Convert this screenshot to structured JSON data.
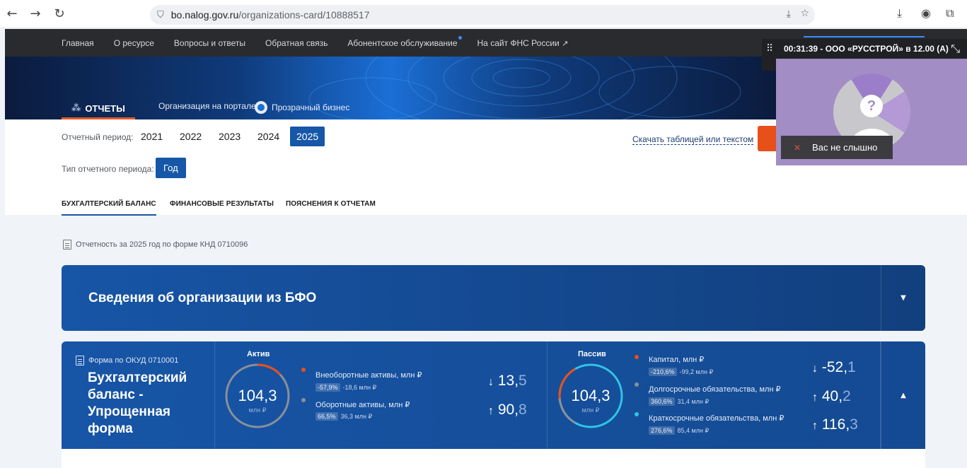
{
  "browser": {
    "url_host": "bo.nalog.gov.ru",
    "url_path": "/organizations-card/10888517"
  },
  "site_nav": {
    "items": [
      "Главная",
      "О ресурсе",
      "Вопросы и ответы",
      "Обратная связь",
      "Абонентское обслуживание",
      "На сайт ФНС России"
    ]
  },
  "hero": {
    "tab_label": "ОТЧЕТЫ",
    "org_portal": "Организация на портале",
    "transparent_business": "Прозрачный бизнес"
  },
  "filters": {
    "period_label": "Отчетный период:",
    "years": [
      "2021",
      "2022",
      "2023",
      "2024",
      "2025"
    ],
    "selected_year": "2025",
    "period_type_label": "Тип отчетного периода:",
    "period_type_value": "Год",
    "download_link": "Скачать таблицей или текстом"
  },
  "subtabs": [
    "БУХГАЛТЕРСКИЙ БАЛАНС",
    "ФИНАНСОВЫЕ РЕЗУЛЬТАТЫ",
    "ПОЯСНЕНИЯ К ОТЧЕТАМ"
  ],
  "report_note": "Отчетность за 2025 год по форме КНД 0710096",
  "org_card": {
    "title": "Сведения об организации из БФО"
  },
  "balance": {
    "okud": "Форма по ОКУД 0710001",
    "title": "Бухгалтерский баланс - Упрощенная форма",
    "aktiv": {
      "label": "Актив",
      "total": "104,3",
      "unit": "млн ₽",
      "items": [
        {
          "name": "Внеоборотные активы, млн ₽",
          "pct": "-57,9%",
          "delta": "-18,6 млн ₽",
          "arrow": "↓",
          "value_int": "13,",
          "value_frac": "5",
          "color": "#e8501a"
        },
        {
          "name": "Оборотные активы, млн ₽",
          "pct": "66,5%",
          "delta": "36,3 млн ₽",
          "arrow": "↑",
          "value_int": "90,",
          "value_frac": "8",
          "color": "#8a8f99"
        }
      ]
    },
    "passiv": {
      "label": "Пассив",
      "total": "104,3",
      "unit": "млн ₽",
      "items": [
        {
          "name": "Капитал, млн ₽",
          "pct": "-210,6%",
          "delta": "-99,2 млн ₽",
          "arrow": "↓",
          "value_int": "-52,",
          "value_frac": "1",
          "color": "#e8501a"
        },
        {
          "name": "Долгосрочные обязательства, млн ₽",
          "pct": "360,6%",
          "delta": "31,4 млн ₽",
          "arrow": "↑",
          "value_int": "40,",
          "value_frac": "2",
          "color": "#8a8f99"
        },
        {
          "name": "Краткосрочные обязательства, млн ₽",
          "pct": "276,6%",
          "delta": "85,4 млн ₽",
          "arrow": "↑",
          "value_int": "116,",
          "value_frac": "3",
          "color": "#2ec4e6"
        }
      ]
    }
  },
  "video_overlay": {
    "title": "00:31:39 - ООО «РУССТРОЙ» в 12.00 (А)",
    "mute_text": "Вас не слышно"
  }
}
